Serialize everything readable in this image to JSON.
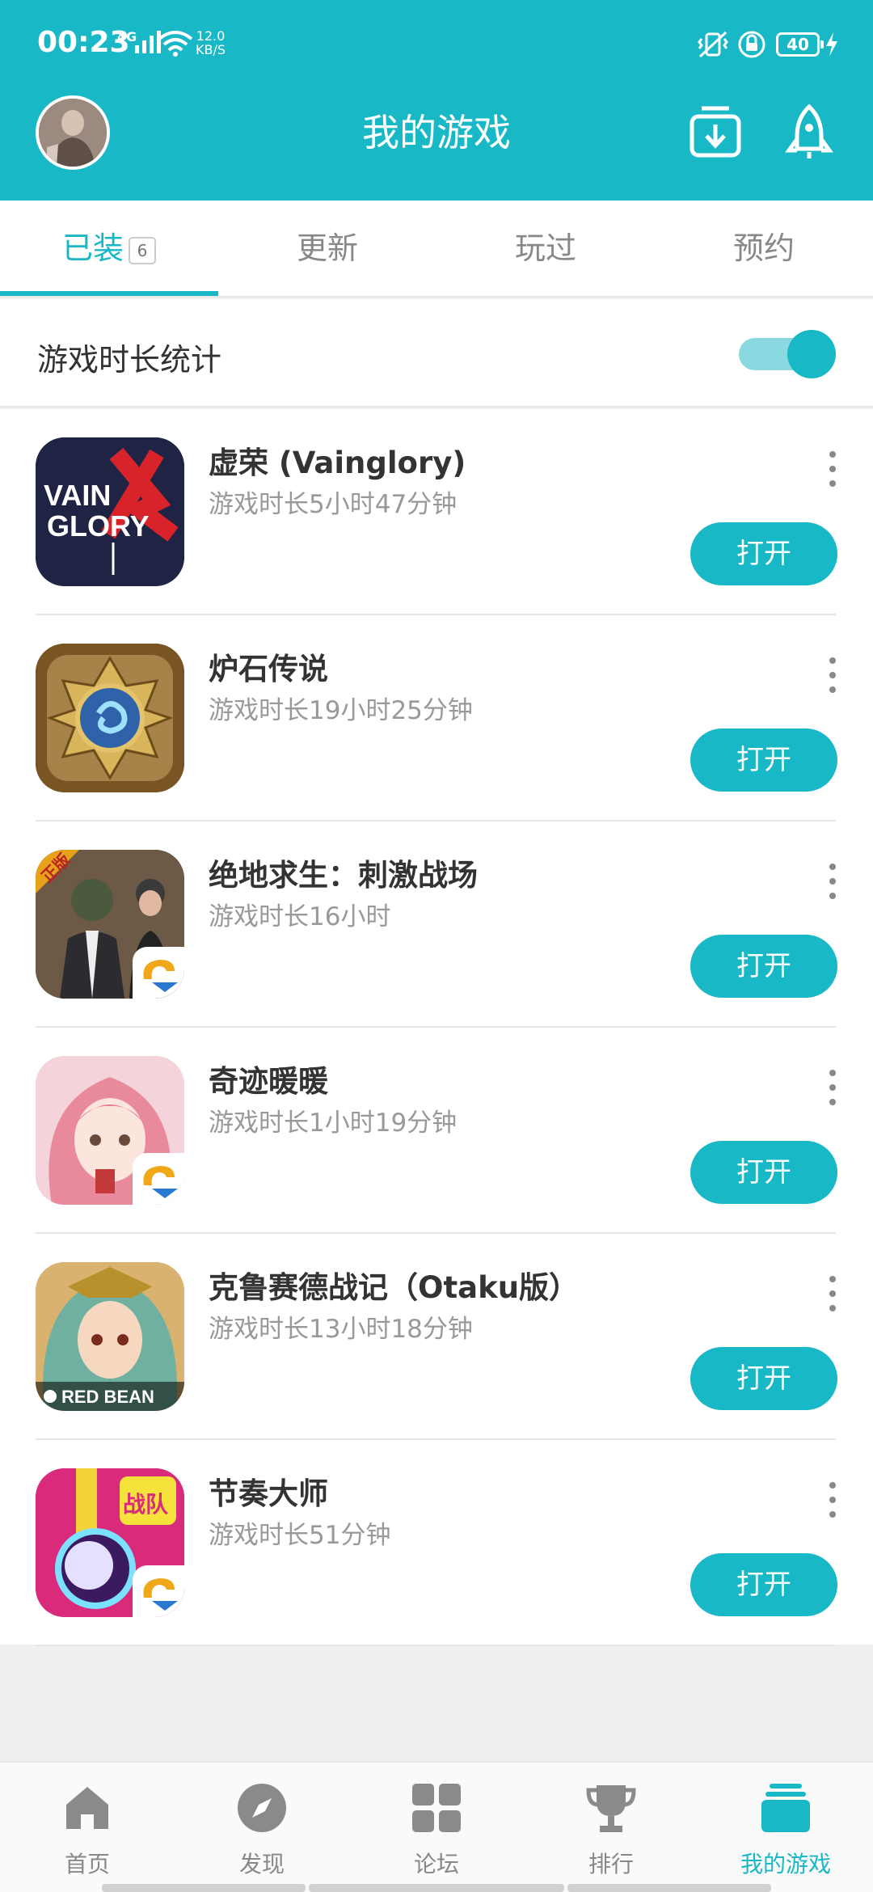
{
  "colors": {
    "accent": "#19b8c6",
    "background": "#efefef"
  },
  "status_bar": {
    "time": "00:23",
    "network": "4G",
    "speed_value": "12.0",
    "speed_unit": "KB/S",
    "battery": "40",
    "icons": [
      "signal-icon",
      "wifi-icon",
      "vibrate-icon",
      "lock-rotation-icon",
      "battery-icon",
      "charging-icon"
    ]
  },
  "header": {
    "title": "我的游戏",
    "icons": [
      "avatar",
      "download-icon",
      "rocket-icon"
    ]
  },
  "tabs": [
    {
      "label": "已装",
      "badge": "6",
      "active": true
    },
    {
      "label": "更新"
    },
    {
      "label": "玩过"
    },
    {
      "label": "预约"
    }
  ],
  "stats": {
    "label": "游戏时长统计",
    "toggle_on": true
  },
  "games": [
    {
      "name": "虚荣 (Vainglory)",
      "playtime": "游戏时长5小时47分钟",
      "action": "打开"
    },
    {
      "name": "炉石传说",
      "playtime": "游戏时长19小时25分钟",
      "action": "打开"
    },
    {
      "name": "绝地求生：刺激战场",
      "playtime": "游戏时长16小时",
      "action": "打开"
    },
    {
      "name": "奇迹暖暖",
      "playtime": "游戏时长1小时19分钟",
      "action": "打开"
    },
    {
      "name": "克鲁赛德战记（Otaku版）",
      "playtime": "游戏时长13小时18分钟",
      "action": "打开"
    },
    {
      "name": "节奏大师",
      "playtime": "游戏时长51分钟",
      "action": "打开"
    }
  ],
  "icon_text": {
    "vainglory": [
      "VAIN",
      "GLORY"
    ],
    "pubg_tag": "正版",
    "red_bean": "RED BEAN",
    "rhythm_tag": "战队"
  },
  "bottom_nav": [
    {
      "label": "首页",
      "icon": "home-icon"
    },
    {
      "label": "发现",
      "icon": "compass-icon"
    },
    {
      "label": "论坛",
      "icon": "grid-icon"
    },
    {
      "label": "排行",
      "icon": "trophy-icon"
    },
    {
      "label": "我的游戏",
      "icon": "my-games-icon",
      "active": true
    }
  ]
}
